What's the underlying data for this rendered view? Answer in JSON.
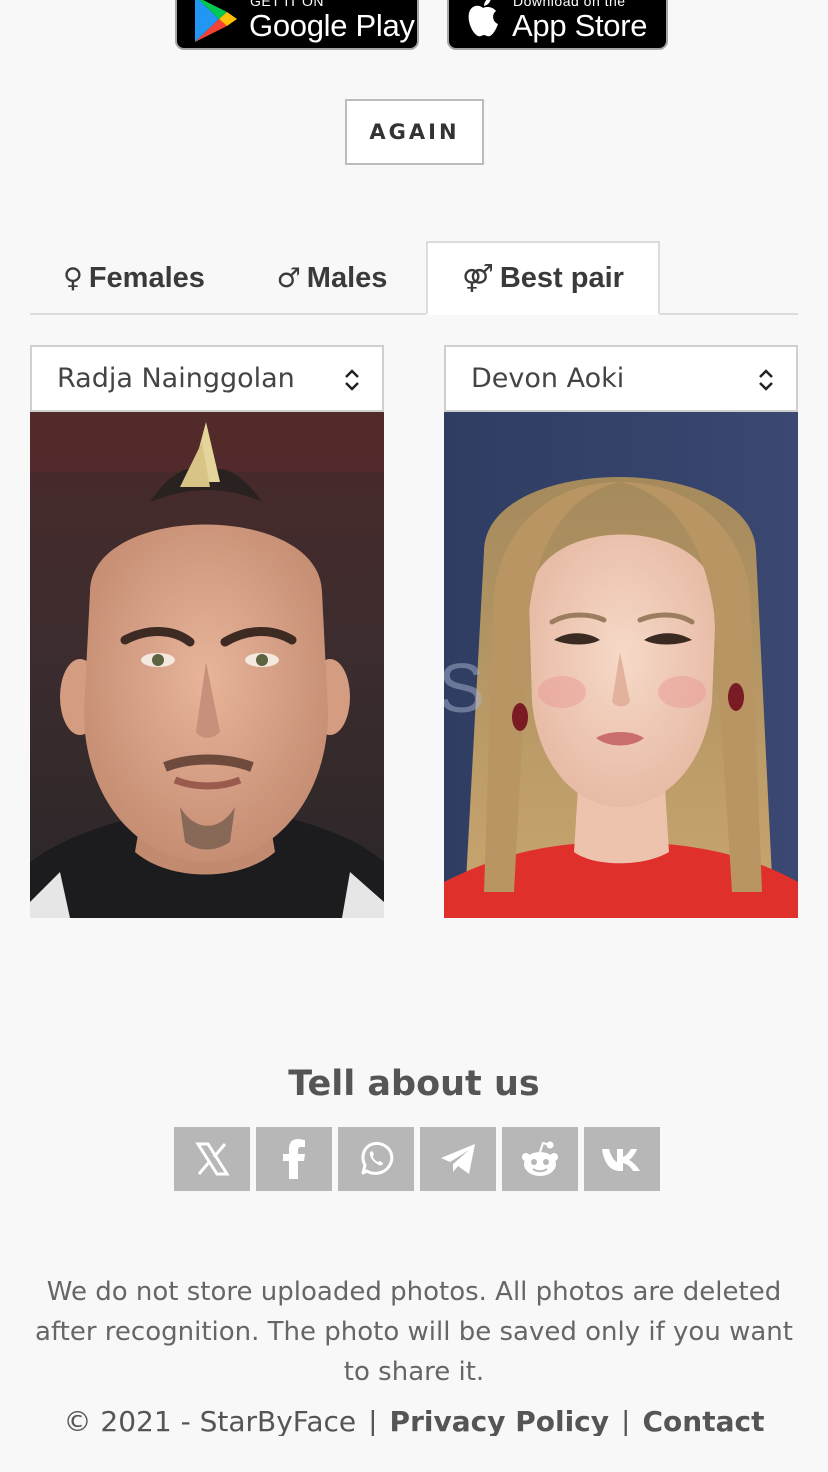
{
  "badges": {
    "google": {
      "small": "GET IT ON",
      "big": "Google Play"
    },
    "apple": {
      "small": "Download on the",
      "big": "App Store"
    }
  },
  "again_label": "AGAIN",
  "tabs": [
    {
      "symbol": "♀",
      "label": "Females",
      "active": false
    },
    {
      "symbol": "♂",
      "label": "Males",
      "active": false
    },
    {
      "symbol": "⚤",
      "label": "Best pair",
      "active": true
    }
  ],
  "pair": {
    "left_select": "Radja Nainggolan",
    "right_select": "Devon Aoki"
  },
  "share": {
    "title": "Tell about us",
    "buttons": [
      "x-icon",
      "facebook-icon",
      "whatsapp-icon",
      "telegram-icon",
      "reddit-icon",
      "vk-icon"
    ]
  },
  "footer": {
    "notice": "We do not store uploaded photos. All photos are deleted after recognition. The photo will be saved only if you want to share it.",
    "copyright": "© 2021 - StarByFace",
    "privacy": "Privacy Policy",
    "contact": "Contact"
  },
  "colors": {
    "background": "#f8f8f8",
    "share_button": "#b7b7b7",
    "text": "#3a3a3a"
  }
}
